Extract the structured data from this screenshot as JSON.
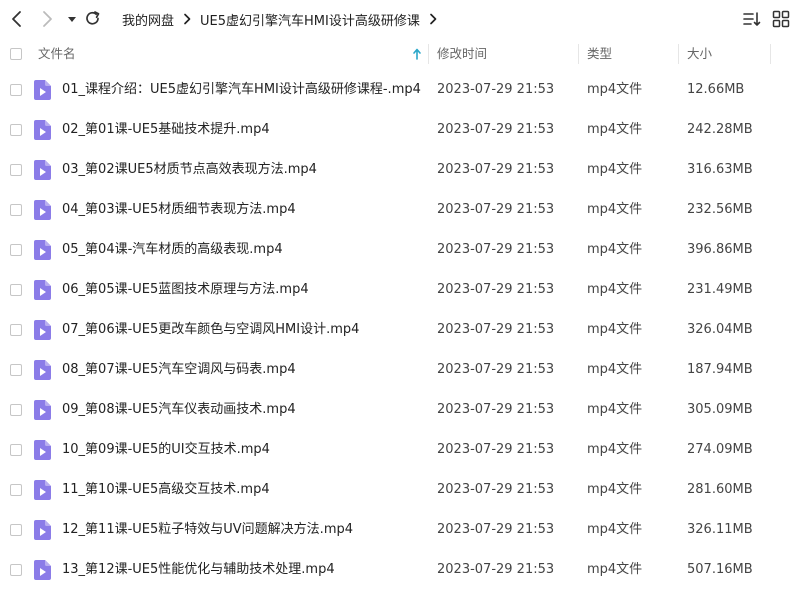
{
  "toolbar": {
    "breadcrumbs": [
      "我的网盘",
      "UE5虚幻引擎汽车HMI设计高级研修课"
    ]
  },
  "header": {
    "name": "文件名",
    "modified": "修改时间",
    "type": "类型",
    "size": "大小"
  },
  "files": [
    {
      "name": "01_课程介绍：UE5虚幻引擎汽车HMI设计高级研修课程-.mp4",
      "modified": "2023-07-29 21:53",
      "type": "mp4文件",
      "size": "12.66MB"
    },
    {
      "name": "02_第01课-UE5基础技术提升.mp4",
      "modified": "2023-07-29 21:53",
      "type": "mp4文件",
      "size": "242.28MB"
    },
    {
      "name": "03_第02课UE5材质节点高效表现方法.mp4",
      "modified": "2023-07-29 21:53",
      "type": "mp4文件",
      "size": "316.63MB"
    },
    {
      "name": "04_第03课-UE5材质细节表现方法.mp4",
      "modified": "2023-07-29 21:53",
      "type": "mp4文件",
      "size": "232.56MB"
    },
    {
      "name": "05_第04课-汽车材质的高级表现.mp4",
      "modified": "2023-07-29 21:53",
      "type": "mp4文件",
      "size": "396.86MB"
    },
    {
      "name": "06_第05课-UE5蓝图技术原理与方法.mp4",
      "modified": "2023-07-29 21:53",
      "type": "mp4文件",
      "size": "231.49MB"
    },
    {
      "name": "07_第06课-UE5更改车颜色与空调风HMI设计.mp4",
      "modified": "2023-07-29 21:53",
      "type": "mp4文件",
      "size": "326.04MB"
    },
    {
      "name": "08_第07课-UE5汽车空调风与码表.mp4",
      "modified": "2023-07-29 21:53",
      "type": "mp4文件",
      "size": "187.94MB"
    },
    {
      "name": "09_第08课-UE5汽车仪表动画技术.mp4",
      "modified": "2023-07-29 21:53",
      "type": "mp4文件",
      "size": "305.09MB"
    },
    {
      "name": "10_第09课-UE5的UI交互技术.mp4",
      "modified": "2023-07-29 21:53",
      "type": "mp4文件",
      "size": "274.09MB"
    },
    {
      "name": "11_第10课-UE5高级交互技术.mp4",
      "modified": "2023-07-29 21:53",
      "type": "mp4文件",
      "size": "281.60MB"
    },
    {
      "name": "12_第11课-UE5粒子特效与UV问题解决方法.mp4",
      "modified": "2023-07-29 21:53",
      "type": "mp4文件",
      "size": "326.11MB"
    },
    {
      "name": "13_第12课-UE5性能优化与辅助技术处理.mp4",
      "modified": "2023-07-29 21:53",
      "type": "mp4文件",
      "size": "507.16MB"
    }
  ],
  "colors": {
    "file_icon": "#8b7ce8",
    "sort_arrow": "#2aa7c9"
  }
}
